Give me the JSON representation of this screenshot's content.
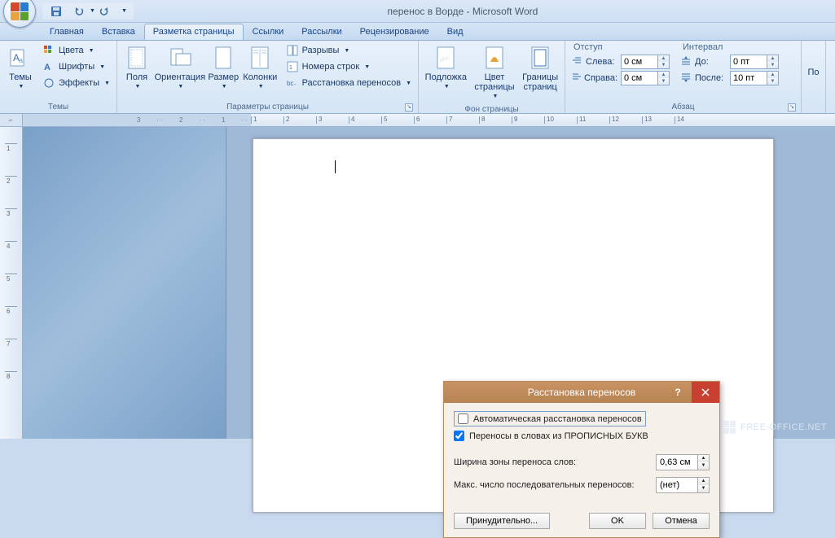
{
  "title": "перенос в Ворде - Microsoft Word",
  "qat": {
    "save": "save",
    "undo": "undo",
    "redo": "redo"
  },
  "tabs": [
    "Главная",
    "Вставка",
    "Разметка страницы",
    "Ссылки",
    "Рассылки",
    "Рецензирование",
    "Вид"
  ],
  "active_tab_index": 2,
  "ribbon": {
    "themes": {
      "label": "Темы",
      "big": "Темы",
      "colors": "Цвета",
      "fonts": "Шрифты",
      "effects": "Эффекты"
    },
    "page_setup": {
      "label": "Параметры страницы",
      "margins": "Поля",
      "orientation": "Ориентация",
      "size": "Размер",
      "columns": "Колонки",
      "breaks": "Разрывы",
      "line_numbers": "Номера строк",
      "hyphenation": "Расстановка переносов"
    },
    "page_bg": {
      "label": "Фон страницы",
      "watermark": "Подложка",
      "page_color": "Цвет\nстраницы",
      "page_borders": "Границы\nстраниц"
    },
    "paragraph": {
      "label": "Абзац",
      "indent_header": "Отступ",
      "left": "Слева:",
      "right": "Справа:",
      "left_val": "0 см",
      "right_val": "0 см",
      "spacing_header": "Интервал",
      "before": "До:",
      "after": "После:",
      "before_val": "0 пт",
      "after_val": "10 пт"
    },
    "arrange_overflow": "По"
  },
  "ruler": {
    "neg": [
      "3",
      "2",
      "1"
    ],
    "pos": [
      "1",
      "2",
      "3",
      "4",
      "5",
      "6",
      "7",
      "8",
      "9",
      "10",
      "11",
      "12",
      "13",
      "14"
    ],
    "vert": [
      "1",
      "2",
      "3",
      "4",
      "5",
      "6",
      "7",
      "8"
    ]
  },
  "dialog": {
    "title": "Расстановка переносов",
    "auto": "Автоматическая расстановка переносов",
    "auto_checked": false,
    "caps": "Переносы в словах из ПРОПИСНЫХ БУКВ",
    "caps_checked": true,
    "zone_label": "Ширина зоны переноса слов:",
    "zone_val": "0,63 см",
    "max_label": "Макс. число последовательных переносов:",
    "max_val": "(нет)",
    "force": "Принудительно...",
    "ok": "OK",
    "cancel": "Отмена"
  },
  "watermark": "FREE-OFFICE.NET"
}
